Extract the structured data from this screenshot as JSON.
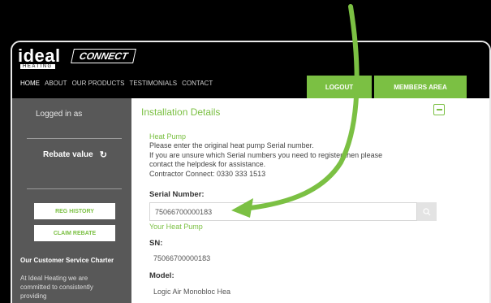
{
  "logo": {
    "brand": "ideal",
    "sub": "HEATING",
    "product": "CONNECT"
  },
  "nav": [
    "HOME",
    "ABOUT",
    "OUR PRODUCTS",
    "TESTIMONIALS",
    "CONTACT"
  ],
  "header_buttons": {
    "logout": "LOGOUT",
    "members": "MEMBERS AREA"
  },
  "sidebar": {
    "logged_in": "Logged in as",
    "rebate_value": "Rebate value",
    "reg_history": "REG HISTORY",
    "claim_rebate": "CLAIM REBATE",
    "charter_title": "Our Customer Service Charter",
    "charter_text": "At Ideal Heating we are committed to consistently providing"
  },
  "main": {
    "title": "Installation Details",
    "section_heat_pump": "Heat Pump",
    "line1": "Please enter the original heat pump Serial number.",
    "line2": "If you are unsure which Serial numbers you need to register then please",
    "line3": "contact the helpdesk for assistance.",
    "line4": "Contractor Connect: 0330 333 1513",
    "serial_label": "Serial Number:",
    "serial_value": "75066700000183",
    "your_heat_pump": "Your Heat Pump",
    "sn_label": "SN:",
    "sn_value": "75066700000183",
    "model_label": "Model:",
    "model_value": "Logic Air Monobloc Hea"
  },
  "colors": {
    "accent": "#7bc043",
    "arrow": "#7bc043",
    "sidebar": "#585858"
  }
}
